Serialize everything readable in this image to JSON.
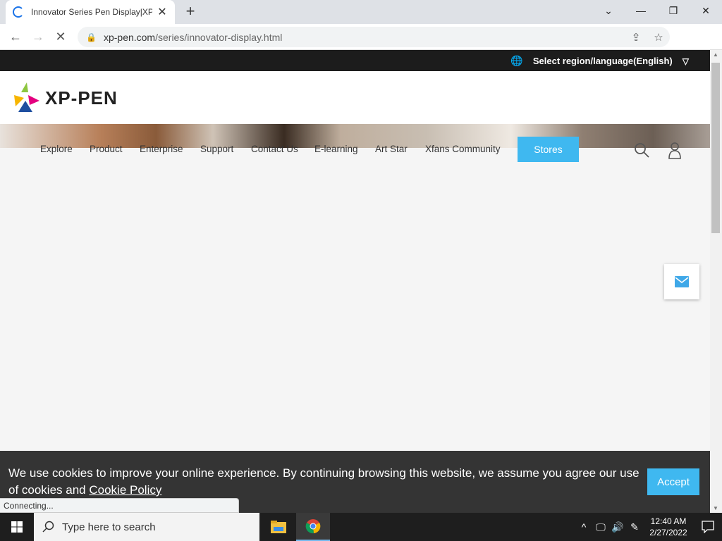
{
  "browser": {
    "tab_title": "Innovator Series Pen Display|XP-",
    "url_host": "xp-pen.com",
    "url_path": "/series/innovator-display.html",
    "status_text": "Connecting..."
  },
  "site": {
    "region_label": "Select region/language(English)",
    "logo_text": "XP-PEN",
    "nav": [
      "Explore",
      "Product",
      "Enterprise",
      "Support",
      "Contact Us",
      "E-learning",
      "Art Star",
      "Xfans Community"
    ],
    "stores_label": "Stores",
    "accent_color": "#3fb8f0"
  },
  "cookie": {
    "text": "We use cookies to improve your online experience. By continuing browsing this website, we assume you agree our use of cookies and",
    "link_text": "Cookie Policy",
    "accept_label": "Accept"
  },
  "taskbar": {
    "search_placeholder": "Type here to search",
    "time": "12:40 AM",
    "date": "2/27/2022"
  }
}
